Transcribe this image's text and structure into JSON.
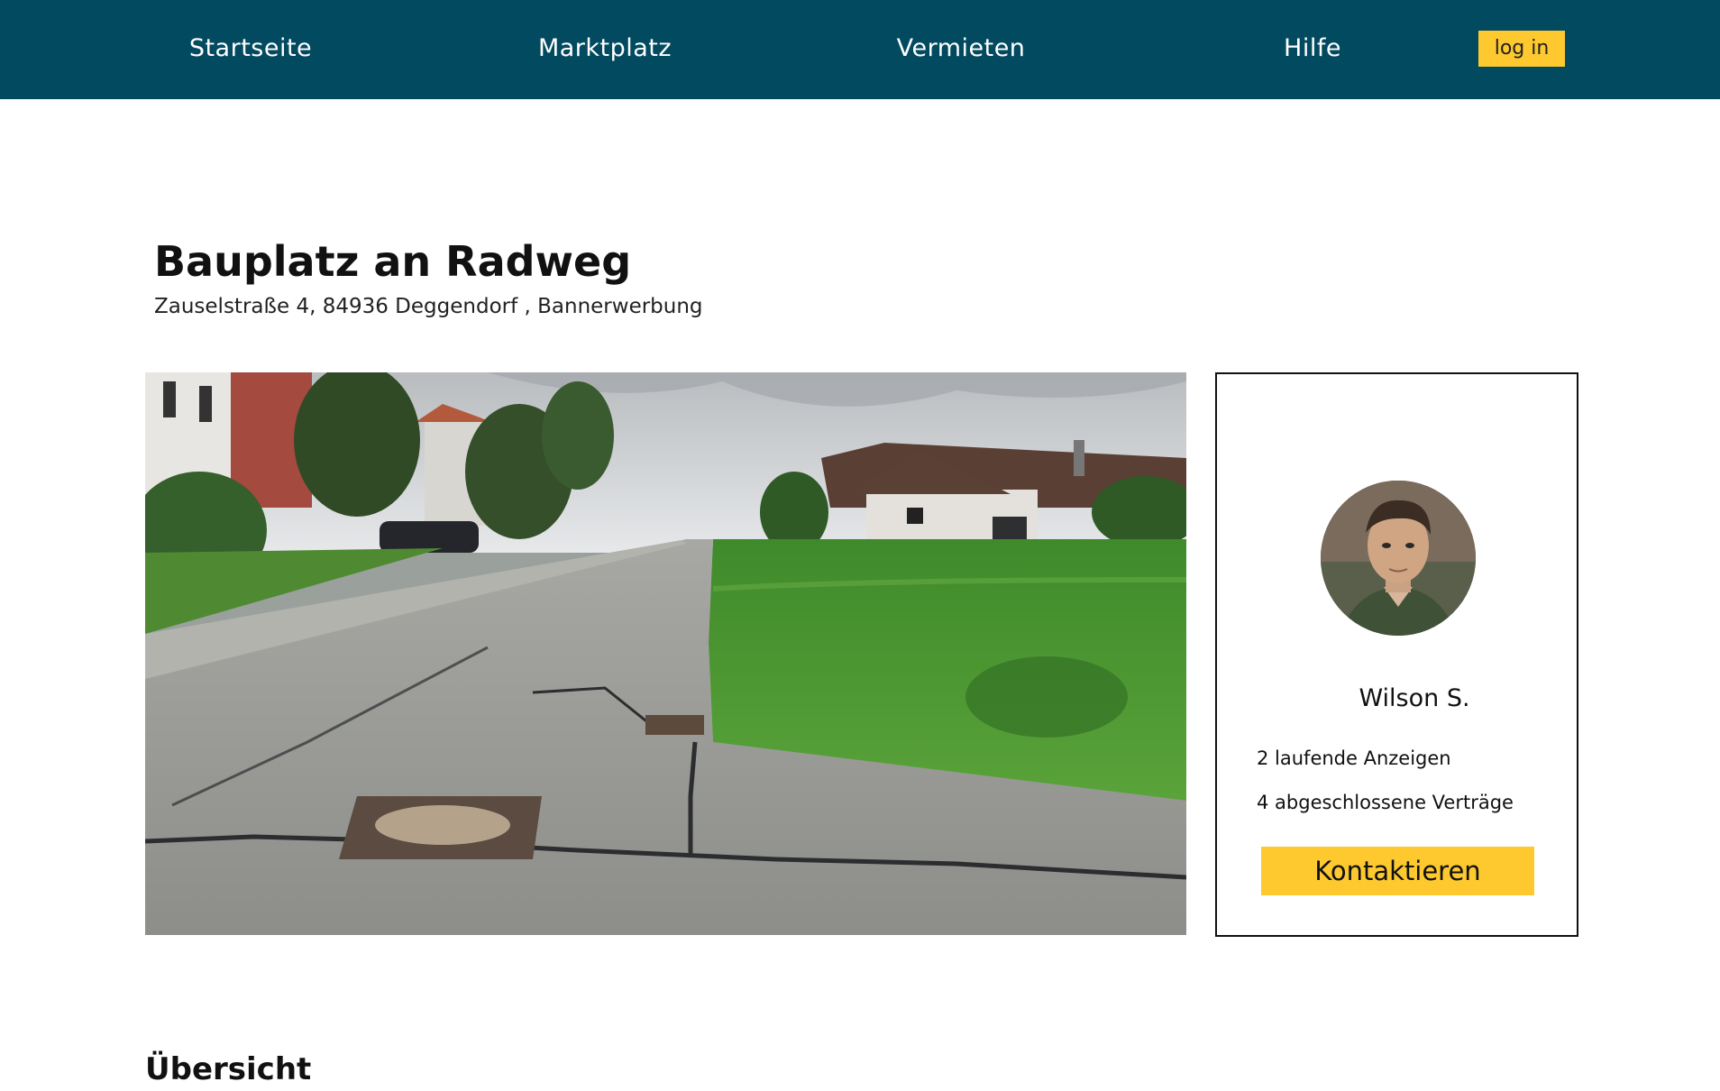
{
  "nav": {
    "items": [
      {
        "label": "Startseite"
      },
      {
        "label": "Marktplatz"
      },
      {
        "label": "Vermieten"
      },
      {
        "label": "Hilfe"
      }
    ],
    "login_label": "log in"
  },
  "listing": {
    "title": "Bauplatz an Radweg",
    "address": "Zauselstraße 4, 84936 Deggendorf , Bannerwerbung"
  },
  "owner": {
    "name": "Wilson S.",
    "active_listings": "2 laufende Anzeigen",
    "closed_contracts": "4 abgeschlossene Verträge",
    "contact_label": "Kontaktieren"
  },
  "section": {
    "overview_title": "Übersicht"
  },
  "colors": {
    "nav_background": "#024a60",
    "accent": "#fdc92f"
  }
}
